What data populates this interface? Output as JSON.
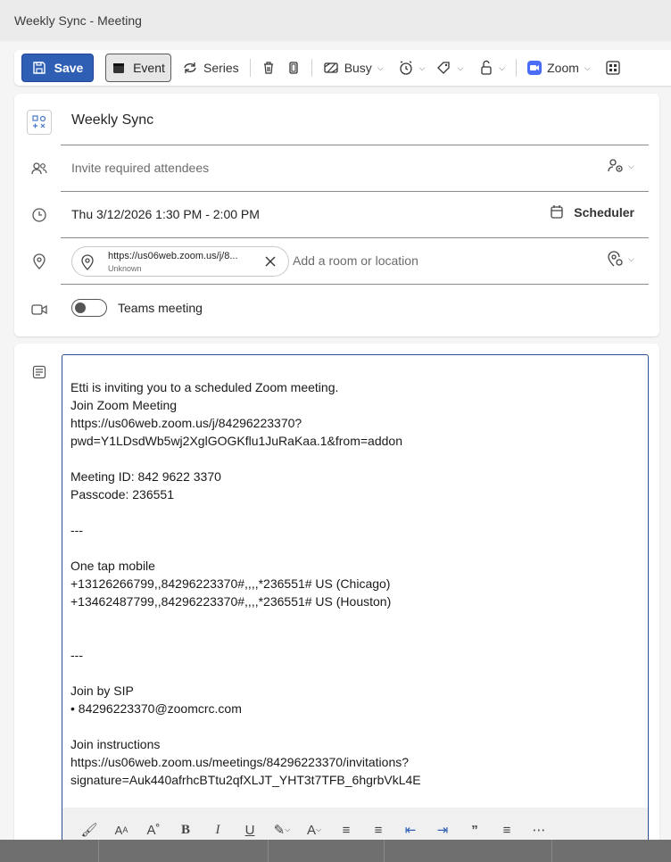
{
  "window": {
    "title": "Weekly Sync - Meeting"
  },
  "toolbar": {
    "save_label": "Save",
    "event_label": "Event",
    "series_label": "Series",
    "busy_label": "Busy",
    "zoom_label": "Zoom"
  },
  "form": {
    "title_value": "Weekly Sync",
    "attendees_placeholder": "Invite required attendees",
    "datetime_value": "Thu 3/12/2026 1:30 PM - 2:00 PM",
    "scheduler_label": "Scheduler",
    "location_chip_url": "https://us06web.zoom.us/j/8...",
    "location_chip_status": "Unknown",
    "location_placeholder": "Add a room or location",
    "teams_label": "Teams meeting",
    "teams_enabled": false
  },
  "body_lines": [
    " Etti is inviting you to a scheduled Zoom meeting.",
    "Join Zoom Meeting",
    "https://us06web.zoom.us/j/84296223370?",
    "pwd=Y1LDsdWb5wj2XglGOGKflu1JuRaKaa.1&from=addon",
    "",
    "Meeting ID: 842 9622 3370",
    "Passcode: 236551",
    "",
    "---",
    "",
    "One tap mobile",
    "+13126266799,,84296223370#,,,,*236551# US (Chicago)",
    "+13462487799,,84296223370#,,,,*236551# US (Houston)",
    "",
    "",
    "---",
    "",
    "Join by SIP",
    "• 84296223370@zoomcrc.com",
    "",
    "Join instructions",
    "https://us06web.zoom.us/meetings/84296223370/invitations?",
    "signature=Auk440afrhcBTtu2qfXLJT_YHT3t7TFB_6hgrbVkL4E"
  ],
  "colors": {
    "accent": "#2f5fb4",
    "zoom": "#4a6cf7"
  }
}
